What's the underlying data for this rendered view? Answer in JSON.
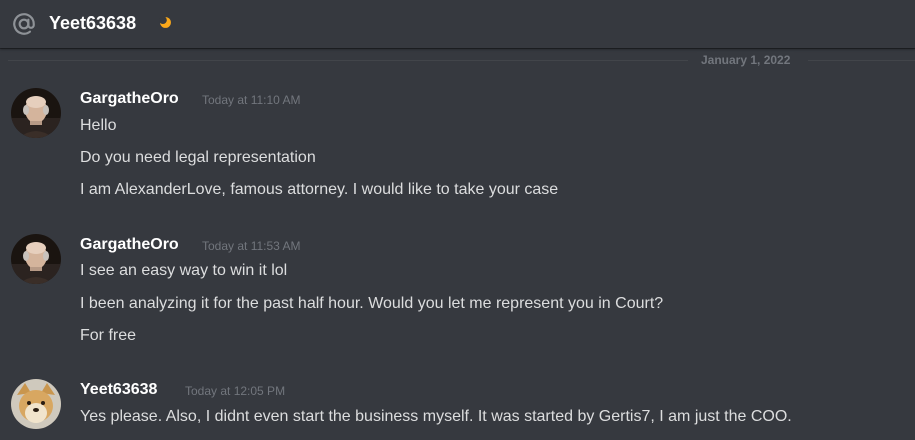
{
  "header": {
    "at_icon": "at-sign-icon",
    "username": "Yeet63638",
    "status_icon": "idle-moon-icon",
    "status_color": "#faa81a"
  },
  "date_divider": "January 1, 2022",
  "messages": [
    {
      "author": "GargatheOro",
      "avatar": "bald-man-portrait-avatar",
      "timestamp": "Today at 11:10 AM",
      "lines": [
        "Hello",
        "Do you need legal representation",
        "I am AlexanderLove, famous attorney. I would like to take your case"
      ]
    },
    {
      "author": "GargatheOro",
      "avatar": "bald-man-portrait-avatar",
      "timestamp": "Today at 11:53 AM",
      "lines": [
        "I see an easy way to win it lol",
        "I been analyzing it for the past half hour. Would you let me represent you in Court?",
        "For free"
      ]
    },
    {
      "author": "Yeet63638",
      "avatar": "doge-shiba-avatar",
      "timestamp": "Today at 12:05 PM",
      "lines": [
        "Yes please. Also, I didnt even start the business myself. It was started by Gertis7, I am just the COO."
      ]
    }
  ],
  "colors": {
    "background": "#36393f",
    "author": "#ffffff",
    "text": "#dcddde",
    "muted": "#72767d",
    "divider": "#42454a"
  }
}
